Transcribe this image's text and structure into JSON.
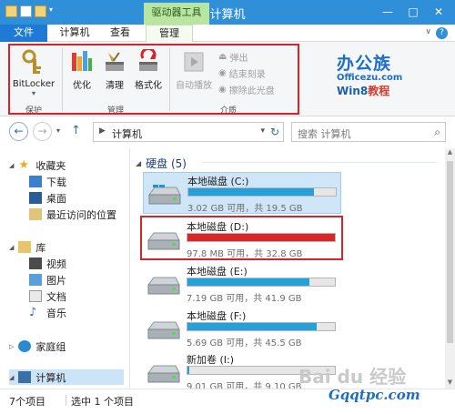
{
  "window": {
    "title": "计算机",
    "context_tab": "驱动器工具",
    "controls": [
      "—",
      "□",
      "✕"
    ]
  },
  "ribbon_tabs": [
    "文件",
    "计算机",
    "查看",
    "管理"
  ],
  "ribbon": {
    "groups": {
      "protect": {
        "label": "保护",
        "bitlocker": "BitLocker"
      },
      "manage": {
        "label": "管理",
        "optimize": "优化",
        "cleanup": "清理",
        "format": "格式化"
      },
      "media": {
        "label": "介质",
        "autoplay": "自动播放",
        "eject": "弹出",
        "finish_burn": "结束刻录",
        "erase": "擦除此光盘"
      }
    }
  },
  "logo": {
    "brand": "办公族",
    "url": "Officezu.com",
    "win8": "Win8",
    "tutorial": "教程"
  },
  "address": {
    "crumb": "计算机",
    "search_placeholder": "搜索 计算机"
  },
  "nav": {
    "favorites": "收藏夹",
    "favorites_items": [
      "下载",
      "桌面",
      "最近访问的位置"
    ],
    "libraries": "库",
    "library_items": [
      "视频",
      "图片",
      "文档",
      "音乐"
    ],
    "homegroup": "家庭组",
    "computer": "计算机"
  },
  "section": {
    "title": "硬盘 (5)"
  },
  "drives": [
    {
      "name": "本地磁盘 (C:)",
      "info": "3.02 GB 可用，共 19.5 GB",
      "used_fraction": 0.85,
      "color": "#26a0da",
      "selected": true
    },
    {
      "name": "本地磁盘 (D:)",
      "info": "97.8 MB 可用，共 32.8 GB",
      "used_fraction": 0.997,
      "color": "#da2626",
      "selected": false
    },
    {
      "name": "本地磁盘 (E:)",
      "info": "7.19 GB 可用，共 41.9 GB",
      "used_fraction": 0.83,
      "color": "#26a0da",
      "selected": false
    },
    {
      "name": "本地磁盘 (F:)",
      "info": "5.69 GB 可用，共 45.5 GB",
      "used_fraction": 0.875,
      "color": "#26a0da",
      "selected": false
    },
    {
      "name": "新加卷 (I:)",
      "info": "9.01 GB 可用，共 9.10 GB",
      "used_fraction": 0.01,
      "color": "#26a0da",
      "selected": false
    }
  ],
  "status": {
    "count": "7个项目",
    "selected": "选中 1 个项目"
  },
  "watermark": {
    "text": "Bai du 经验",
    "site": "Gqqtpc.com"
  },
  "colors": {
    "titlebar": "#2f8fd8",
    "file_tab": "#1f7ad6",
    "context_tab": "#b9e5a2",
    "highlight": "#d6252a"
  }
}
